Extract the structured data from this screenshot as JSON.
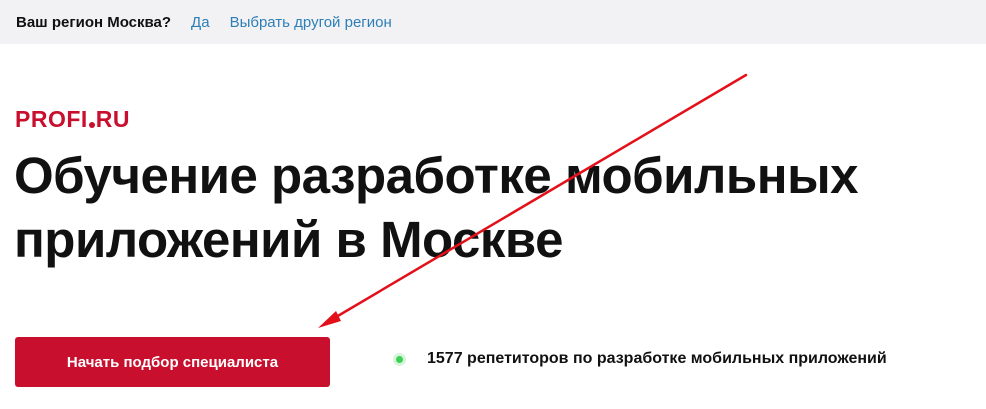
{
  "region_bar": {
    "question": "Ваш регион Москва?",
    "yes_link": "Да",
    "other_region_link": "Выбрать другой регион"
  },
  "logo": {
    "part1": "PROFI",
    "part2": "RU"
  },
  "hero": {
    "title_line1": "Обучение разработке мобильных",
    "title_line2": "приложений в Москве",
    "cta_label": "Начать подбор специалиста",
    "stat_text": "1577 репетиторов по разработке мобильных приложений"
  },
  "colors": {
    "brand_red": "#c8102e",
    "link_blue": "#2e7fb8",
    "online_green": "#3ecf55",
    "arrow_red": "#e3101a"
  },
  "icons": {
    "online_indicator": "green-dot-icon",
    "annotation": "red-arrow-icon"
  }
}
